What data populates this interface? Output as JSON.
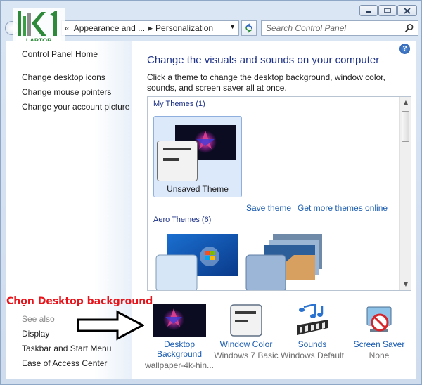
{
  "window": {
    "caption_buttons": [
      "minimize-icon",
      "maximize-icon",
      "close-icon"
    ]
  },
  "address": {
    "prefix": "«",
    "crumb_1": "Appearance and ...",
    "crumb_2": "Personalization",
    "search_placeholder": "Search Control Panel"
  },
  "logo": {
    "mark": "k1",
    "caption": "LAPTOP"
  },
  "left_pane": {
    "home": "Control Panel Home",
    "tasks": [
      "Change desktop icons",
      "Change mouse pointers",
      "Change your account picture"
    ],
    "see_also_title": "See also",
    "see_also": [
      "Display",
      "Taskbar and Start Menu",
      "Ease of Access Center"
    ]
  },
  "main": {
    "help": "?",
    "title": "Change the visuals and sounds on your computer",
    "description": "Click a theme to change the desktop background, window color, sounds, and screen saver all at once.",
    "my_themes_header": "My Themes (1)",
    "unsaved_theme": "Unsaved Theme",
    "save_theme": "Save theme",
    "get_more": "Get more themes online",
    "aero_header": "Aero Themes (6)"
  },
  "bottom": {
    "desktop_background": {
      "label": "Desktop Background",
      "sub": "wallpaper-4k-hin..."
    },
    "window_color": {
      "label": "Window Color",
      "sub": "Windows 7 Basic"
    },
    "sounds": {
      "label": "Sounds",
      "sub": "Windows Default"
    },
    "screen_saver": {
      "label": "Screen Saver",
      "sub": "None"
    }
  },
  "annotation": {
    "text": "Chọn Desktop background",
    "color": "#e8141b"
  },
  "colors": {
    "link": "#1a5cb0",
    "title": "#1e3287",
    "frame": "#cfdcee"
  }
}
